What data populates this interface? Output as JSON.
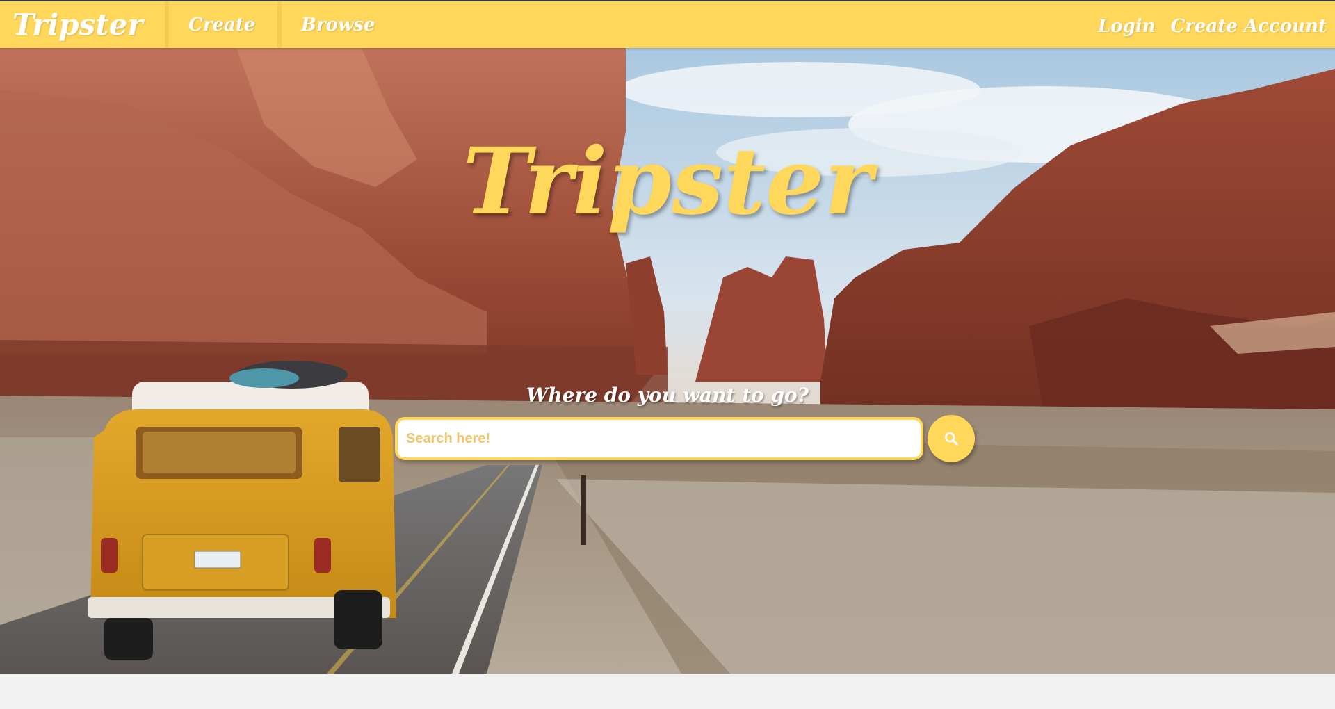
{
  "nav": {
    "brand": "Tripster",
    "links": [
      "Create",
      "Browse"
    ],
    "auth": [
      "Login",
      "Create Account"
    ]
  },
  "hero": {
    "title": "Tripster",
    "subtitle": "Where do you want to go?",
    "search": {
      "placeholder": "Search here!",
      "value": ""
    },
    "search_button_icon": "search-icon",
    "background_description_icon": "desert-road-van-photo"
  },
  "colors": {
    "accent": "#ffd75a",
    "placeholder": "#f3c56a",
    "text_light": "#ffffff"
  }
}
